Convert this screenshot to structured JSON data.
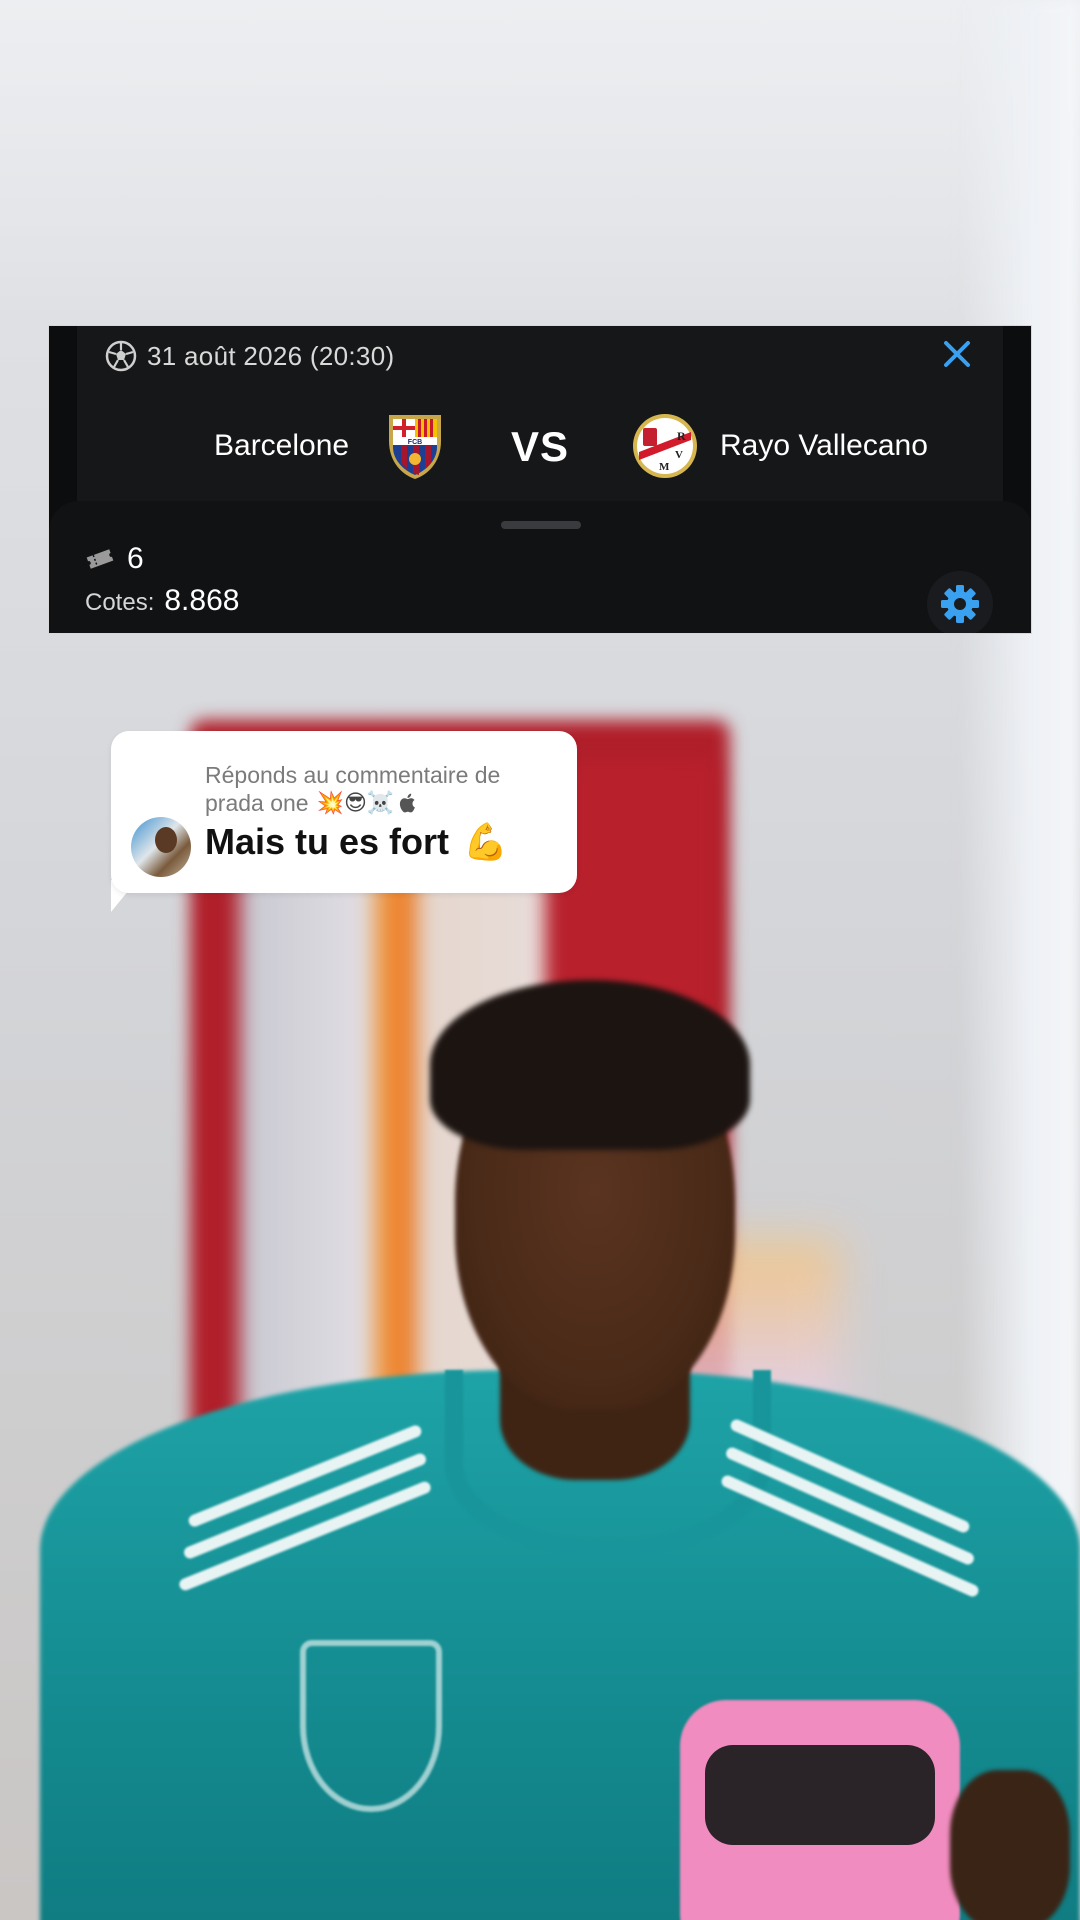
{
  "match": {
    "date": "31 août 2026 (20:30)",
    "home_team": "Barcelone",
    "home_crest_text": "FCB",
    "vs": "VS",
    "away_team": "Rayo Vallecano",
    "away_crest_text": "RVM"
  },
  "bet": {
    "selections": "6",
    "odds_label": "Cotes:",
    "odds_value": "8.868"
  },
  "colors": {
    "accent_blue": "#3aa0f0",
    "card_bg": "#0c0d0f"
  },
  "icons": {
    "date": "soccer-ball-icon",
    "close": "close-icon",
    "ticket": "ticket-icon",
    "settings": "gear-icon"
  },
  "comment": {
    "reply_prefix": "Réponds au commentaire de",
    "author": "prada one",
    "author_emojis": "💥😎☠️",
    "text": "Mais tu es fort",
    "text_emoji": "💪"
  }
}
